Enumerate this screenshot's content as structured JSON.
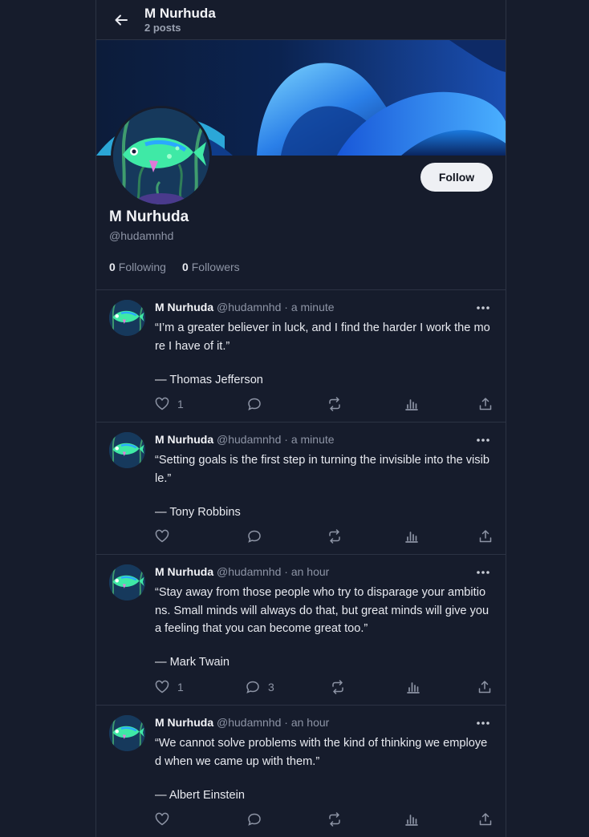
{
  "header": {
    "title": "M Nurhuda",
    "subtitle": "2 posts"
  },
  "profile": {
    "name": "M Nurhuda",
    "handle": "@hudamnhd",
    "follow_label": "Follow",
    "following_count": "0",
    "following_label": "Following",
    "followers_count": "0",
    "followers_label": "Followers"
  },
  "colors": {
    "background": "#161c2c",
    "border": "#2c3344",
    "muted": "#8d94a5",
    "follow_bg": "#eef0f4"
  },
  "icons": [
    "back-arrow-icon",
    "more-icon",
    "heart-icon",
    "reply-icon",
    "repost-icon",
    "views-icon",
    "share-icon"
  ],
  "posts": [
    {
      "name": "M Nurhuda",
      "handle": "@hudamnhd",
      "dot": "·",
      "time": "a minute",
      "text": "“I’m a greater believer in luck, and I find the harder I work the more I have of it.”",
      "author": " — Thomas Jefferson",
      "likes": "1",
      "replies": ""
    },
    {
      "name": "M Nurhuda",
      "handle": "@hudamnhd",
      "dot": "·",
      "time": "a minute",
      "text": "“Setting goals is the first step in turning the invisible into the visible.”",
      "author": "— Tony Robbins",
      "likes": "",
      "replies": ""
    },
    {
      "name": "M Nurhuda",
      "handle": "@hudamnhd",
      "dot": "·",
      "time": "an hour",
      "text": "“Stay away from those people who try to disparage your ambitions. Small minds will always do that, but great minds will give you a feeling that you can become great too.”",
      "author": " — Mark Twain",
      "likes": "1",
      "replies": "3"
    },
    {
      "name": "M Nurhuda",
      "handle": "@hudamnhd",
      "dot": "·",
      "time": "an hour",
      "text": "“We cannot solve problems with the kind of thinking we employed when we came up with them.”",
      "author": "— Albert Einstein",
      "likes": "",
      "replies": ""
    }
  ]
}
